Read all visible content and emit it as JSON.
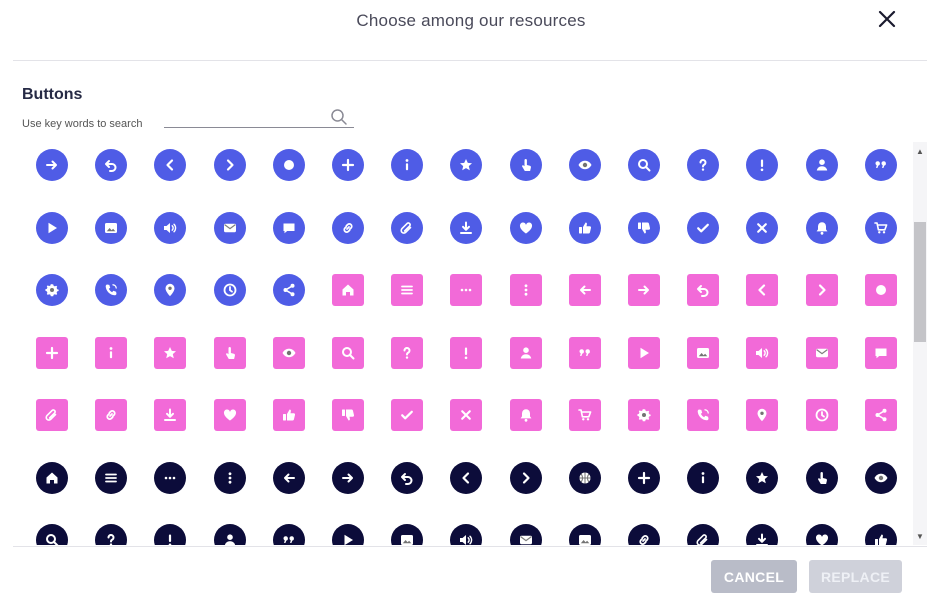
{
  "dialog": {
    "title": "Choose among our resources",
    "close_icon": "close-icon"
  },
  "section": {
    "title": "Buttons",
    "search_label": "Use key words to search",
    "search_value": "",
    "search_icon": "search-icon"
  },
  "colors": {
    "blue": "#4f5ce6",
    "pink": "#f26ad8",
    "navy": "#0c0c3a",
    "glyph": "#ffffff"
  },
  "grid": {
    "rows": [
      {
        "style": "blue-circle",
        "icons": [
          "arrow-right",
          "undo",
          "chevron-left",
          "chevron-right",
          "circle",
          "plus",
          "info",
          "star",
          "pointer",
          "eye",
          "search",
          "question",
          "exclamation",
          "user",
          "quote"
        ]
      },
      {
        "style": "blue-circle",
        "icons": [
          "play",
          "image",
          "volume",
          "mail",
          "chat",
          "link",
          "paperclip",
          "download",
          "heart",
          "thumbs-up",
          "thumbs-down",
          "check",
          "times",
          "bell",
          "cart"
        ]
      },
      {
        "style": "mixed",
        "icons": [
          "gear",
          "phone",
          "location",
          "clock",
          "share",
          "home",
          "menu",
          "ellipsis",
          "ellipsis-vertical",
          "arrow-left",
          "arrow-right",
          "undo",
          "chevron-left",
          "chevron-right",
          "circle"
        ]
      },
      {
        "style": "pink-square",
        "icons": [
          "plus",
          "info",
          "star",
          "pointer",
          "eye",
          "search",
          "question",
          "exclamation",
          "user",
          "quote",
          "play",
          "image",
          "volume",
          "mail",
          "chat"
        ]
      },
      {
        "style": "pink-square",
        "icons": [
          "paperclip",
          "link",
          "download",
          "heart",
          "thumbs-up",
          "thumbs-down",
          "check",
          "times",
          "bell",
          "cart",
          "gear",
          "phone",
          "location",
          "clock",
          "share"
        ]
      },
      {
        "style": "navy-circle",
        "icons": [
          "home",
          "menu",
          "ellipsis",
          "ellipsis-vertical",
          "arrow-left",
          "arrow-right",
          "undo",
          "chevron-left",
          "chevron-right",
          "basketball",
          "plus",
          "info",
          "star",
          "pointer",
          "eye"
        ]
      },
      {
        "style": "navy-circle",
        "icons": [
          "search",
          "question",
          "exclamation",
          "user",
          "quote",
          "play",
          "image",
          "volume",
          "mail",
          "image",
          "link",
          "paperclip",
          "download",
          "heart",
          "thumbs-up"
        ]
      }
    ]
  },
  "footer": {
    "cancel_label": "CANCEL",
    "replace_label": "REPLACE"
  }
}
